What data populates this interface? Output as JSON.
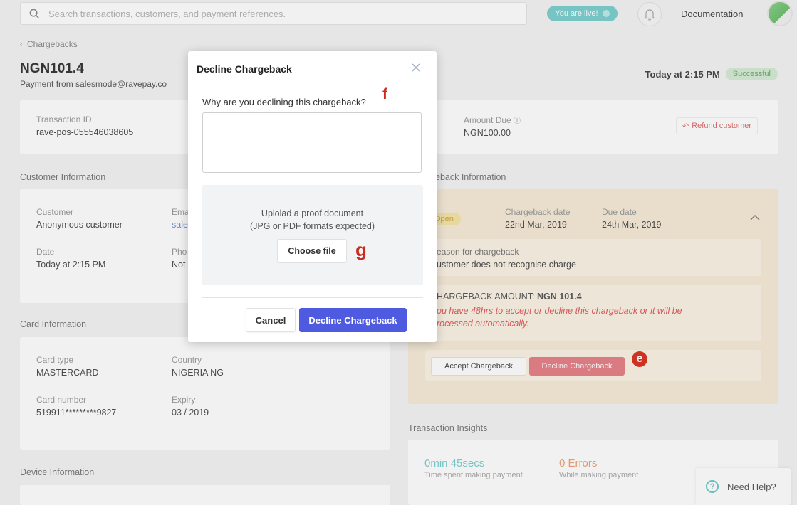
{
  "topbar": {
    "search_placeholder": "Search transactions, customers, and payment references.",
    "live_label": "You are live!",
    "documentation": "Documentation"
  },
  "header": {
    "breadcrumb": "Chargebacks",
    "title": "NGN101.4",
    "subtitle": "Payment from salesmode@ravepay.co",
    "time": "Today at 2:15 PM",
    "status": "Successful"
  },
  "transaction": {
    "id_label": "Transaction ID",
    "id_value": "rave-pos-055546038605",
    "amount_label": "Amount Due",
    "amount_value": "NGN100.00",
    "refund_label": "Refund customer"
  },
  "customer": {
    "section": "Customer Information",
    "customer_label": "Customer",
    "customer_value": "Anonymous customer",
    "email_label": "Ema",
    "email_value": "sale",
    "date_label": "Date",
    "date_value": "Today at 2:15 PM",
    "phone_label": "Pho",
    "phone_value": "Not"
  },
  "card": {
    "section": "Card Information",
    "type_label": "Card type",
    "type_value": "MASTERCARD",
    "country_label": "Country",
    "country_value": "NIGERIA NG",
    "number_label": "Card number",
    "number_value": "519911*********9827",
    "expiry_label": "Expiry",
    "expiry_value": "03 / 2019"
  },
  "device": {
    "section": "Device Information"
  },
  "chargeback": {
    "section": "eback Information",
    "status": "Open",
    "date_label": "Chargeback date",
    "date_value": "22nd Mar, 2019",
    "due_label": "Due date",
    "due_value": "24th Mar, 2019",
    "reason_label": "eason for chargeback",
    "reason_value": "ustomer does not recognise charge",
    "amount_label": "HARGEBACK AMOUNT: ",
    "amount_value": "NGN 101.4",
    "warning_line1": "ou have 48hrs to accept or decline this chargeback or it will be",
    "warning_line2": "rocessed automatically.",
    "accept_label": "Accept Chargeback",
    "decline_label": "Decline Chargeback",
    "colors": {
      "panel": "#f7ebd7",
      "decline": "#e57f85",
      "warning": "#e05a5a"
    }
  },
  "insights": {
    "section": "Transaction Insights",
    "time_value": "0min 45secs",
    "time_label": "Time spent making payment",
    "errors_value": "0 Errors",
    "errors_label": "While making payment"
  },
  "help": {
    "label": "Need Help?"
  },
  "modal": {
    "title": "Decline Chargeback",
    "question": "Why are you declining this chargeback?",
    "upload_line1": "Uplolad a proof document",
    "upload_line2": "(JPG or PDF formats expected)",
    "choose_file": "Choose file",
    "cancel": "Cancel",
    "confirm": "Decline Chargeback",
    "colors": {
      "primary": "#4e5ae0"
    }
  },
  "markers": {
    "e": "e",
    "f": "f",
    "g": "g"
  }
}
